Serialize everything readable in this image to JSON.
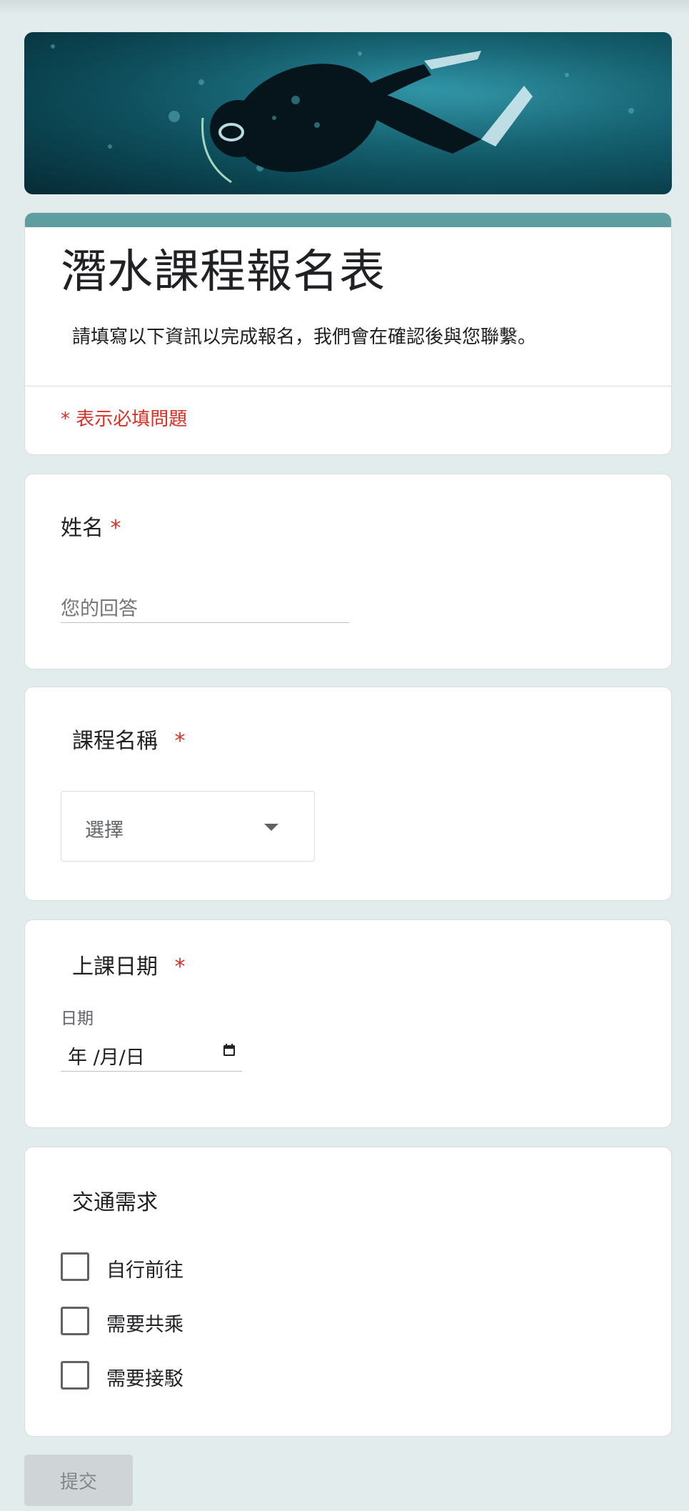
{
  "form": {
    "title": "潛水課程報名表",
    "description": "請填寫以下資訊以完成報名，我們會在確認後與您聯繫。",
    "required_note": "* 表示必填問題",
    "accent_color": "#5f9ea0",
    "required_color": "#d93025"
  },
  "questions": {
    "name": {
      "label": "姓名",
      "required_mark": "*",
      "placeholder": "您的回答",
      "value": ""
    },
    "course": {
      "label": "課程名稱",
      "required_mark": "*",
      "selected": "選擇"
    },
    "date": {
      "label": "上課日期",
      "required_mark": "*",
      "caption": "日期",
      "value": "年 /月/日",
      "icon": "calendar-icon"
    },
    "transport": {
      "label": "交通需求",
      "options": [
        {
          "label": "自行前往",
          "checked": false
        },
        {
          "label": "需要共乘",
          "checked": false
        },
        {
          "label": "需要接駁",
          "checked": false
        }
      ]
    }
  },
  "submit_label": "提交"
}
